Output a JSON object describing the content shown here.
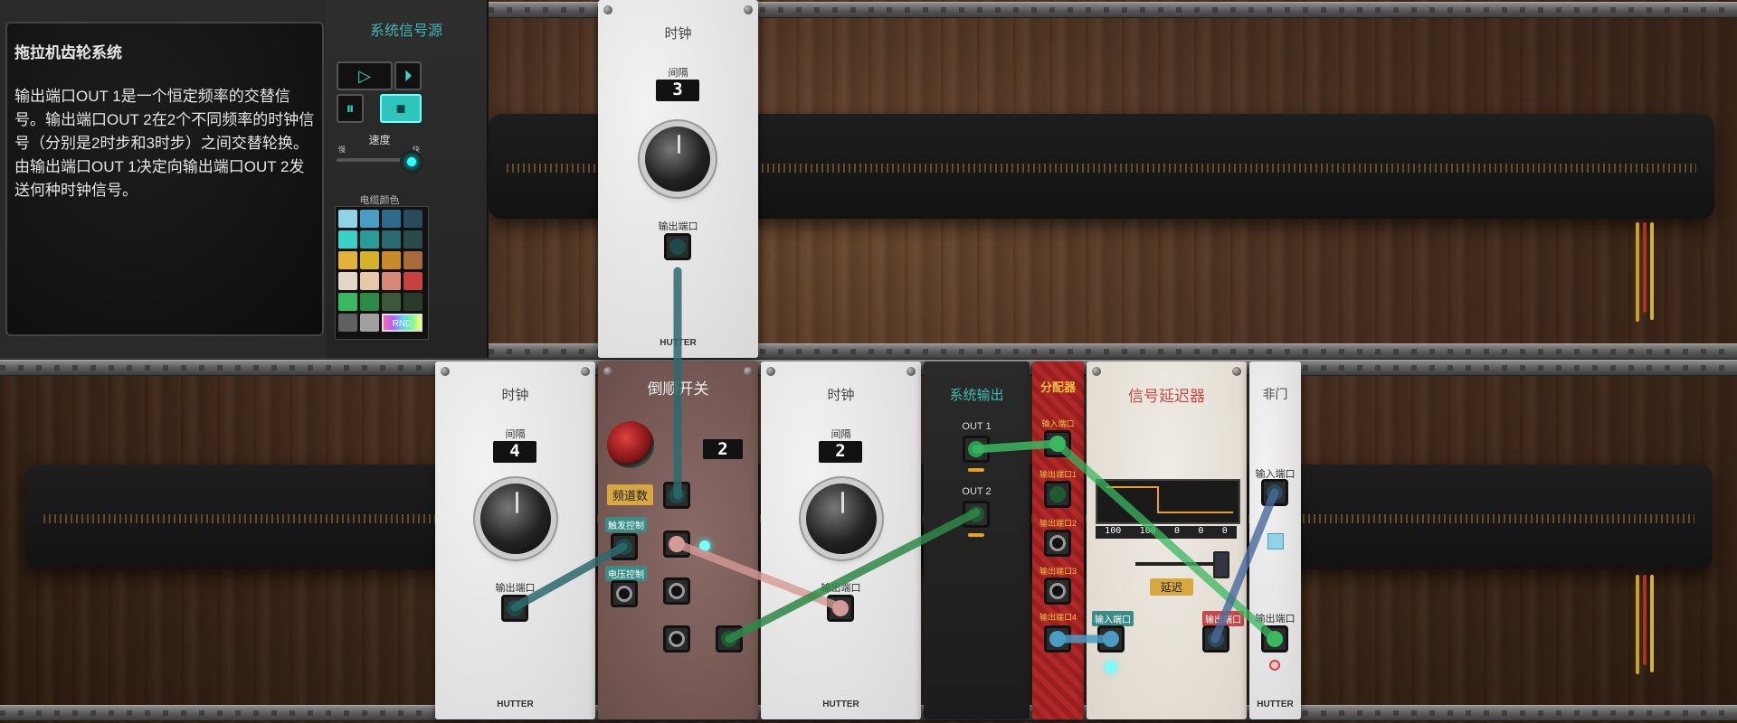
{
  "info": {
    "title": "拖拉机齿轮系统",
    "body": "输出端口OUT 1是一个恒定频率的交替信号。输出端口OUT 2在2个不同频率的时钟信号（分别是2时步和3时步）之间交替轮换。由输出端口OUT 1决定向输出端口OUT 2发送何种时钟信号。"
  },
  "source": {
    "title": "系统信号源",
    "play_icon": "play-icon",
    "step_icon": "step-icon",
    "pause_icon": "pause-icon",
    "stop_icon": "stop-icon",
    "speed_label": "速度",
    "speed_min": "慢",
    "speed_max": "快",
    "speed_level": 0.85,
    "palette_label": "电缆颜色",
    "palette": [
      "#8fd3e6",
      "#4a9cc4",
      "#2d6a8c",
      "#2a4a5c",
      "#3ad1c8",
      "#2a9c98",
      "#2b6b70",
      "#2a4a4c",
      "#e3b23a",
      "#d6b028",
      "#c88a2a",
      "#a86a3a",
      "#e3d8c8",
      "#e8c8a8",
      "#d88878",
      "#c84040",
      "#3ab860",
      "#2e8a48",
      "#3a5a3a",
      "#2a3a2a",
      "#606060",
      "#a0a0a0"
    ],
    "rnd_label": "RND"
  },
  "clock_top": {
    "title": "时钟",
    "interval_label": "间隔",
    "value": "3",
    "out_label": "输出端口",
    "brand": "HUTTER"
  },
  "clock_a": {
    "title": "时钟",
    "interval_label": "间隔",
    "value": "4",
    "out_label": "输出端口",
    "brand": "HUTTER"
  },
  "switch": {
    "title": "倒顺开关",
    "channels_label": "频道数",
    "value": "2",
    "trigger_label": "触发控制",
    "cv_label": "电压控制"
  },
  "clock_b": {
    "title": "时钟",
    "interval_label": "间隔",
    "value": "2",
    "out_label": "输出端口",
    "brand": "HUTTER"
  },
  "sys_out": {
    "title": "系统输出",
    "out1": "OUT 1",
    "out2": "OUT 2"
  },
  "splitter": {
    "title": "分配器",
    "in_label": "输入端口",
    "out1": "输出端口1",
    "out2": "输出端口2",
    "out3": "输出端口3",
    "out4": "输出端口4"
  },
  "delay": {
    "title": "信号延迟器",
    "readout": [
      "100",
      "100",
      "0",
      "0",
      "0"
    ],
    "delay_label": "延迟",
    "in_label": "输入端口",
    "out_label": "输出端口"
  },
  "notgate": {
    "title": "非门",
    "in_label": "输入端口",
    "out_label": "输出端口",
    "brand": "HUTTER"
  },
  "colors": {
    "teal": "#2fc4bc",
    "green": "#3ab860",
    "pink": "#d69a96",
    "blue": "#4a9cc4",
    "cable_teal": "#2d6a6e"
  }
}
